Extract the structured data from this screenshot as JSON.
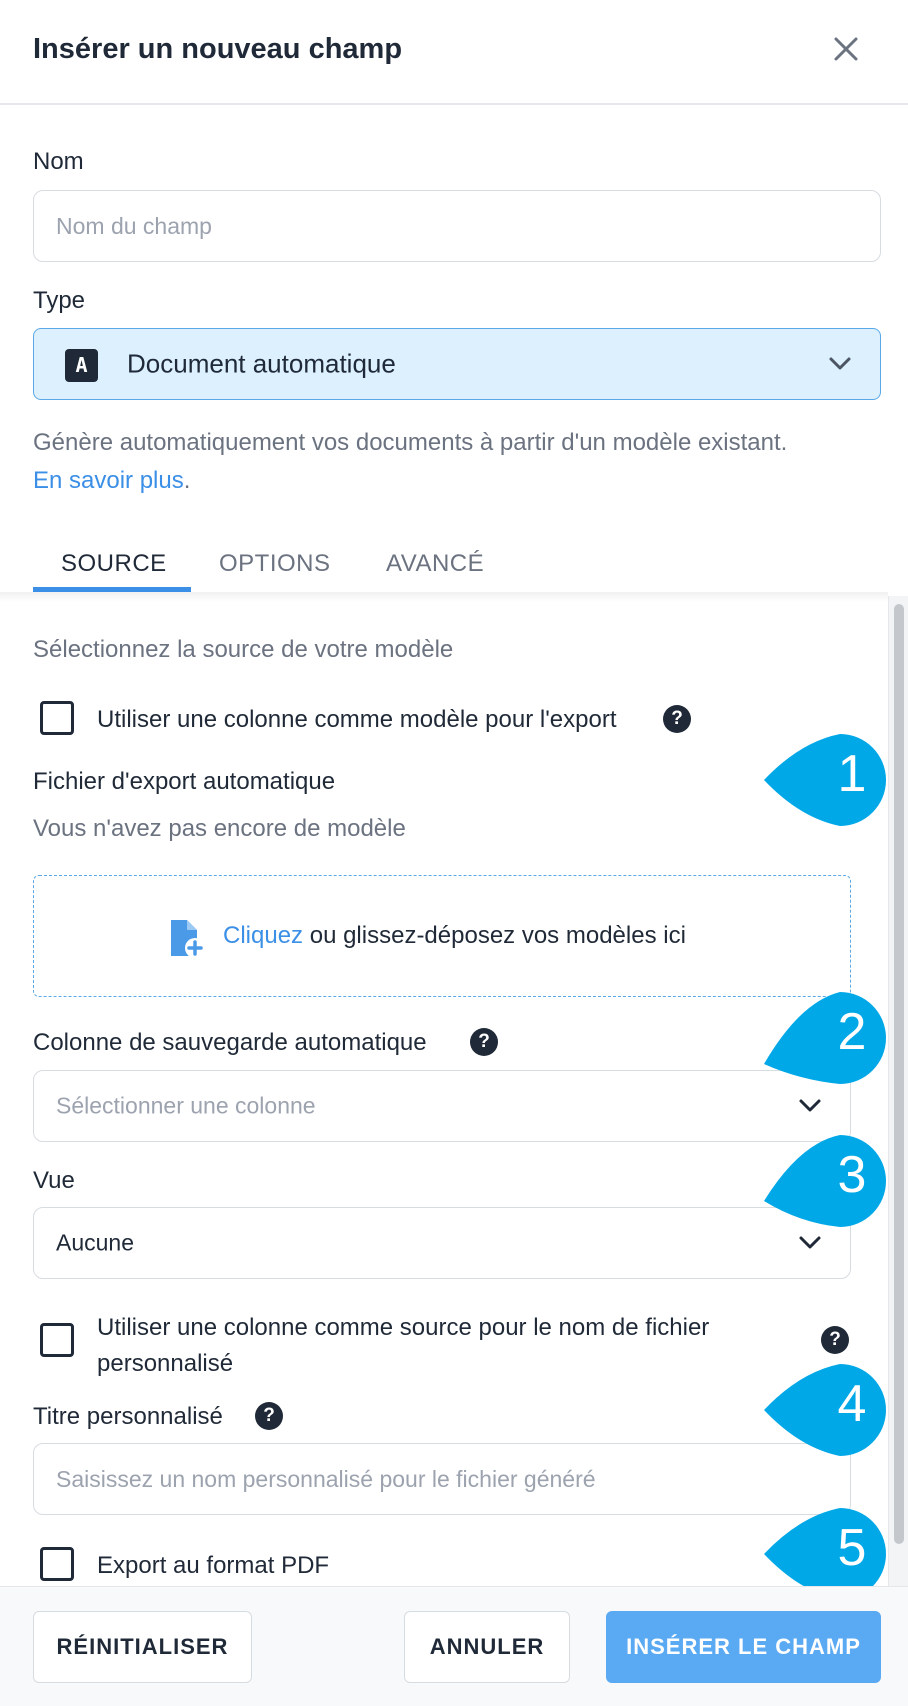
{
  "dialog": {
    "title": "Insérer un nouveau champ"
  },
  "name_field": {
    "label": "Nom",
    "placeholder": "Nom du champ"
  },
  "type_field": {
    "label": "Type",
    "icon_letter": "A",
    "value": "Document automatique",
    "description": "Génère automatiquement vos documents à partir d'un modèle existant.",
    "learn_more": "En savoir plus",
    "learn_more_suffix": "."
  },
  "tabs": [
    {
      "label": "SOURCE",
      "active": true
    },
    {
      "label": "OPTIONS",
      "active": false
    },
    {
      "label": "AVANCÉ",
      "active": false
    }
  ],
  "source": {
    "intro": "Sélectionnez la source de votre modèle",
    "use_column_template": {
      "label": "Utiliser une colonne comme modèle pour l'export",
      "checked": false
    },
    "export_file": {
      "label": "Fichier d'export automatique",
      "empty_text": "Vous n'avez pas encore de modèle",
      "dropzone_link": "Cliquez",
      "dropzone_text": " ou glissez-déposez vos modèles ici"
    },
    "save_column": {
      "label": "Colonne de sauvegarde automatique",
      "placeholder": "Sélectionner une colonne"
    },
    "view": {
      "label": "Vue",
      "value": "Aucune"
    },
    "use_column_filename": {
      "label_line1": "Utiliser une colonne comme source pour le nom de fichier",
      "label_line2": "personnalisé",
      "checked": false
    },
    "custom_title": {
      "label": "Titre personnalisé",
      "placeholder": "Saisissez un nom personnalisé pour le fichier généré"
    },
    "export_pdf": {
      "label": "Export au format PDF",
      "checked": false
    },
    "help_symbol": "?"
  },
  "callouts": [
    "1",
    "2",
    "3",
    "4",
    "5"
  ],
  "footer": {
    "reset": "RÉINITIALISER",
    "cancel": "ANNULER",
    "insert": "INSÉRER LE CHAMP"
  },
  "colors": {
    "accent": "#3b8fe6",
    "type_bg": "#dcf0fd",
    "callout": "#00a8e8",
    "primary_button": "#5aa9f3"
  }
}
